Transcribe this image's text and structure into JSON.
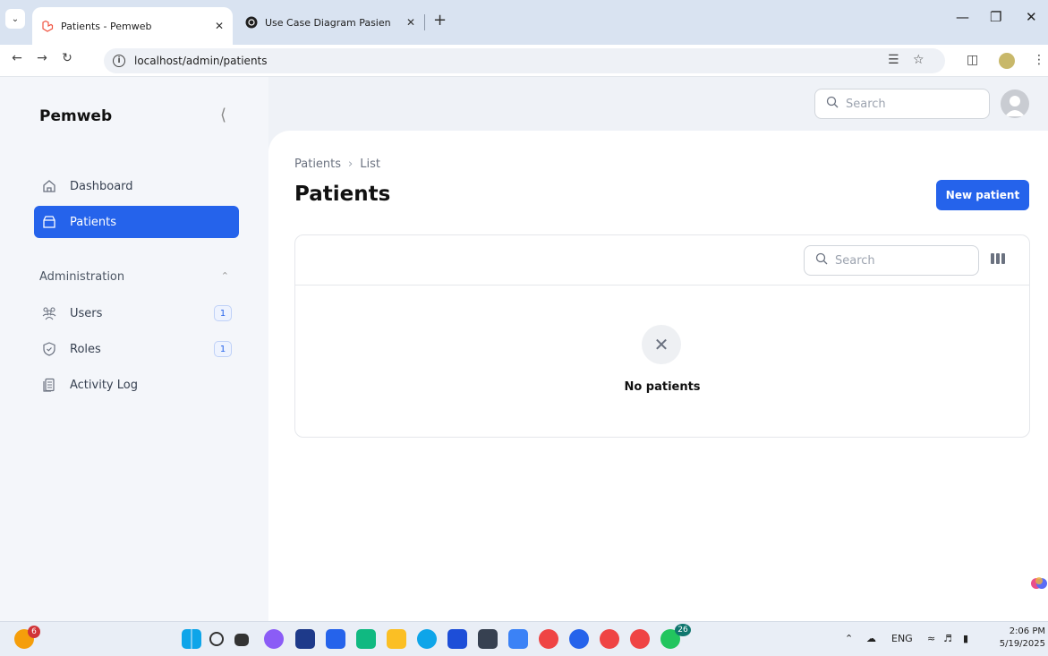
{
  "browser": {
    "tabs": [
      {
        "title": "Patients - Pemweb",
        "active": true
      },
      {
        "title": "Use Case Diagram Pasien",
        "active": false
      }
    ],
    "new_tab": "+",
    "url": "localhost/admin/patients"
  },
  "sidebar": {
    "brand": "Pemweb",
    "items": [
      {
        "label": "Dashboard",
        "icon": "home-icon"
      },
      {
        "label": "Patients",
        "icon": "inbox-icon",
        "active": true
      }
    ],
    "group": {
      "label": "Administration",
      "items": [
        {
          "label": "Users",
          "icon": "users-icon",
          "badge": "1"
        },
        {
          "label": "Roles",
          "icon": "shield-check-icon",
          "badge": "1"
        },
        {
          "label": "Activity Log",
          "icon": "document-icon"
        }
      ]
    }
  },
  "topbar": {
    "search_placeholder": "Search"
  },
  "main": {
    "breadcrumb": [
      "Patients",
      "List"
    ],
    "title": "Patients",
    "new_button": "New patient",
    "table": {
      "search_placeholder": "Search",
      "empty_text": "No patients"
    }
  },
  "taskbar": {
    "notification_count": "6",
    "whatsapp_count": "26",
    "language": "ENG",
    "time": "2:06 PM",
    "date": "5/19/2025"
  },
  "colors": {
    "primary": "#2563eb",
    "sidebar_bg": "#f4f6fa"
  }
}
